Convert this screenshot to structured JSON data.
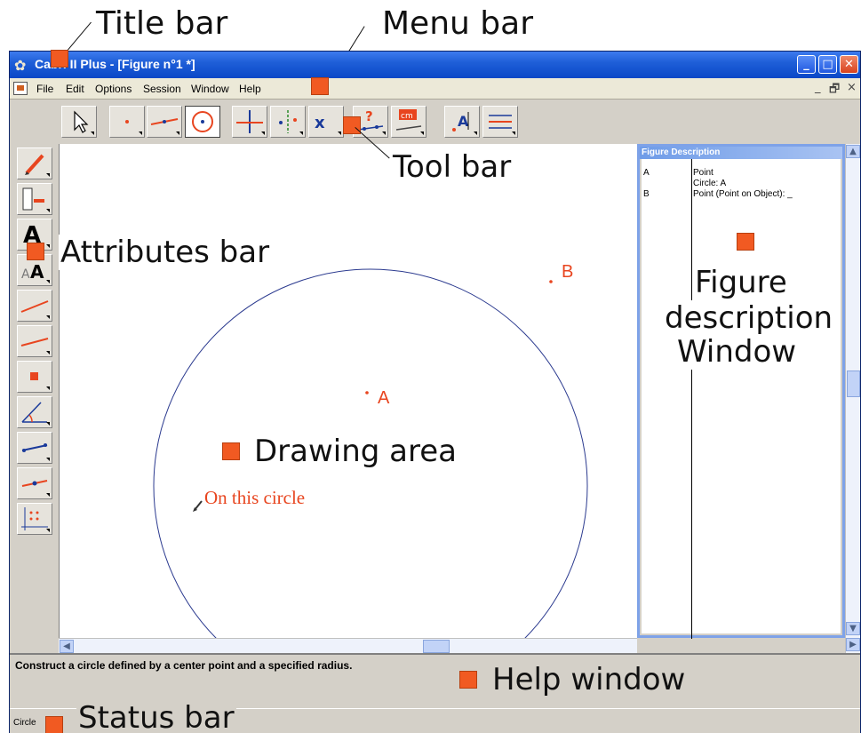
{
  "annotations": {
    "title_bar": "Title bar",
    "menu_bar": "Menu bar",
    "tool_bar": "Tool bar",
    "attributes_bar": "Attributes bar",
    "figure_description_line1": "Figure",
    "figure_description_line2": "description",
    "figure_description_line3": "Window",
    "drawing_area": "Drawing area",
    "help_window": "Help window",
    "status_bar": "Status bar"
  },
  "window": {
    "title": "Cabri II Plus - [Figure n°1 *]",
    "minimize": "_",
    "maximize": "□",
    "close": "✕"
  },
  "menu": {
    "items": [
      "File",
      "Edit",
      "Options",
      "Session",
      "Window",
      "Help"
    ],
    "mdi_minimize": "_",
    "mdi_restore": "🗗",
    "mdi_close": "×"
  },
  "toolbar": {
    "icons": [
      "pointer-tool",
      "points-tool",
      "lines-tool",
      "curves-tool",
      "constructions-tool",
      "transformations-tool",
      "macro-tool",
      "check-property-tool",
      "measure-tool",
      "display-tool",
      "draw-tool"
    ]
  },
  "drawing": {
    "point_a_label": "A",
    "point_b_label": "B",
    "cursor_hint": "On this circle",
    "accent_color": "#e8451f",
    "circle_color": "#2b3a8f"
  },
  "figure_description": {
    "header": "Figure Description",
    "rows": [
      {
        "name": "A",
        "desc": "Point"
      },
      {
        "name": "",
        "desc": "Circle: A"
      },
      {
        "name": "B",
        "desc": "Point (Point on Object): _"
      }
    ]
  },
  "help": {
    "text": "Construct a circle defined by a center point and a specified radius."
  },
  "status": {
    "text": "Circle"
  }
}
